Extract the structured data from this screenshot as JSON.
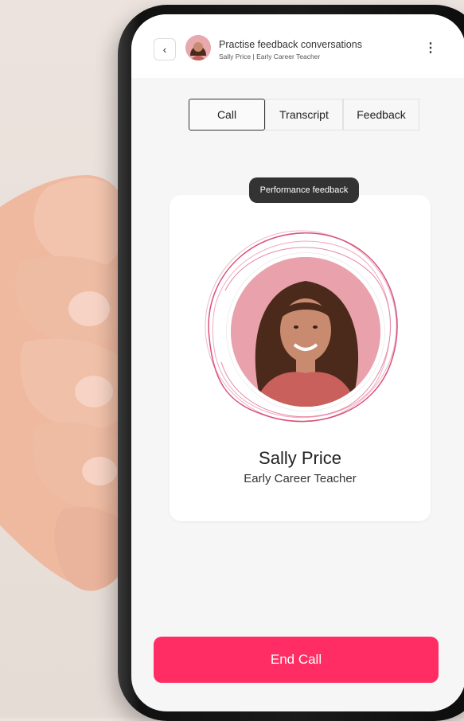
{
  "header": {
    "title": "Practise feedback conversations",
    "subtitle": "Sally Price | Early Career Teacher",
    "back_icon": "chevron-left-icon",
    "more_icon": "vertical-ellipsis-icon"
  },
  "tabs": [
    {
      "label": "Call",
      "active": true
    },
    {
      "label": "Transcript",
      "active": false
    },
    {
      "label": "Feedback",
      "active": false
    }
  ],
  "tooltip": {
    "label": "Performance feedback"
  },
  "profile": {
    "name": "Sally Price",
    "role": "Early Career Teacher"
  },
  "actions": {
    "end_call_label": "End Call"
  },
  "colors": {
    "accent": "#ff2d63",
    "ring": "#d9527a",
    "pill_bg": "#333333",
    "portrait_bg": "#e9a2ab"
  }
}
